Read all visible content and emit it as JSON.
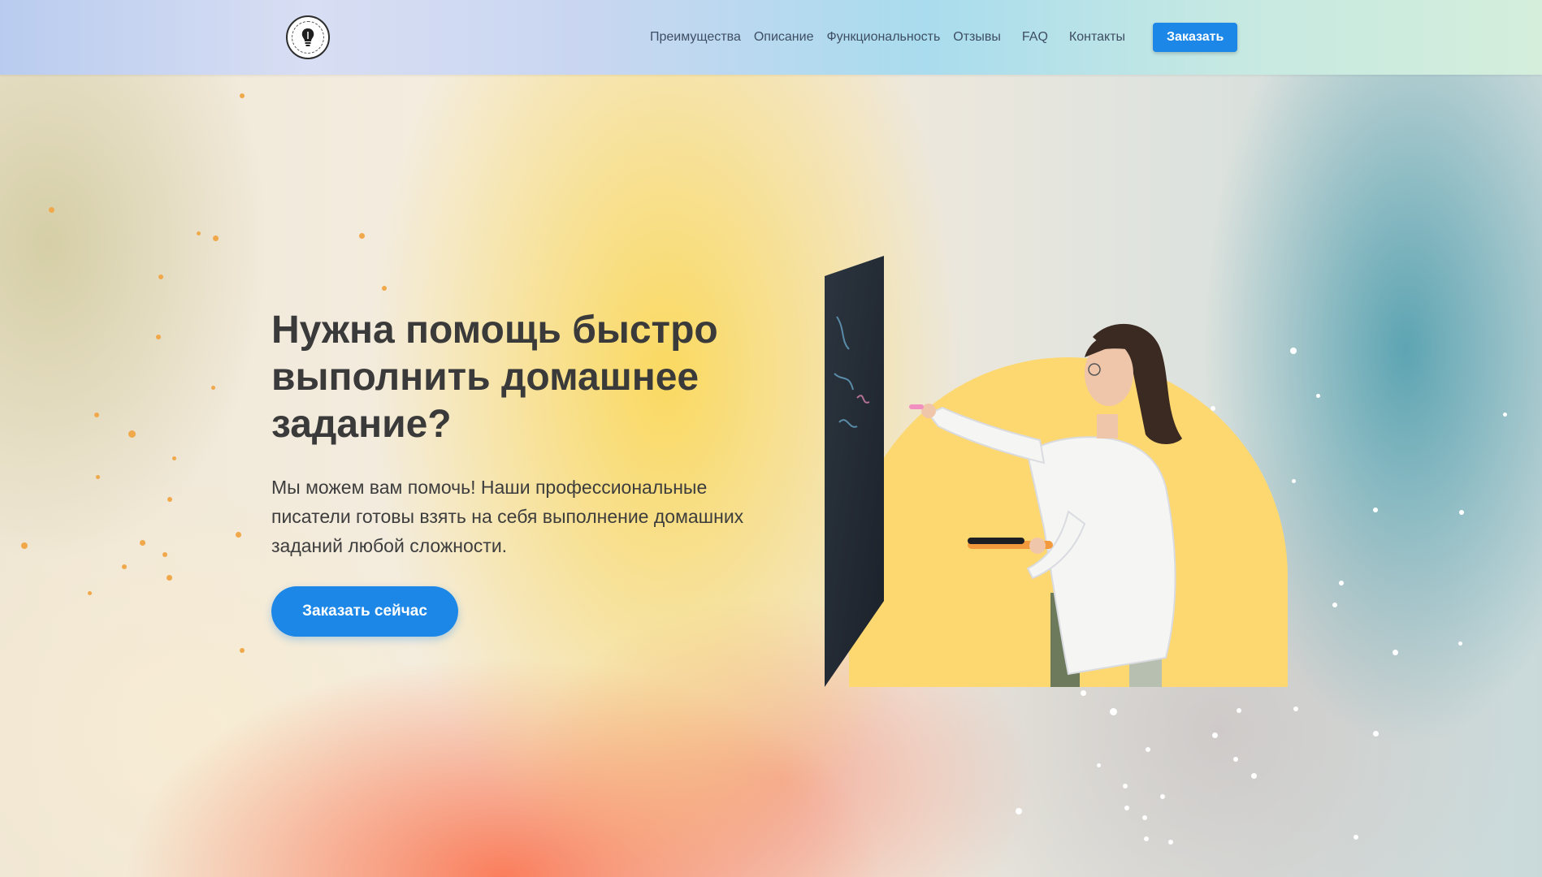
{
  "header": {
    "logo_icon": "lightbulb-seal-logo",
    "nav": [
      {
        "label": "Преимущества"
      },
      {
        "label": "Описание"
      },
      {
        "label": "Функциональность"
      },
      {
        "label": "Отзывы"
      },
      {
        "label": "FAQ"
      },
      {
        "label": "Контакты"
      }
    ],
    "order_button": "Заказать"
  },
  "hero": {
    "title": "Нужна помощь быстро выполнить домашнее задание?",
    "text": "Мы можем вам помочь! Наши профессиональные писатели готовы взять на себя выполнение домашних заданий любой сложности.",
    "cta": "Заказать сейчас",
    "illustration_icon": "woman-writing-on-board-illustration"
  },
  "colors": {
    "accent": "#1c87e6",
    "heading": "#3a3a3a",
    "nav_text": "#3e4e63",
    "circle": "#fdd870"
  }
}
